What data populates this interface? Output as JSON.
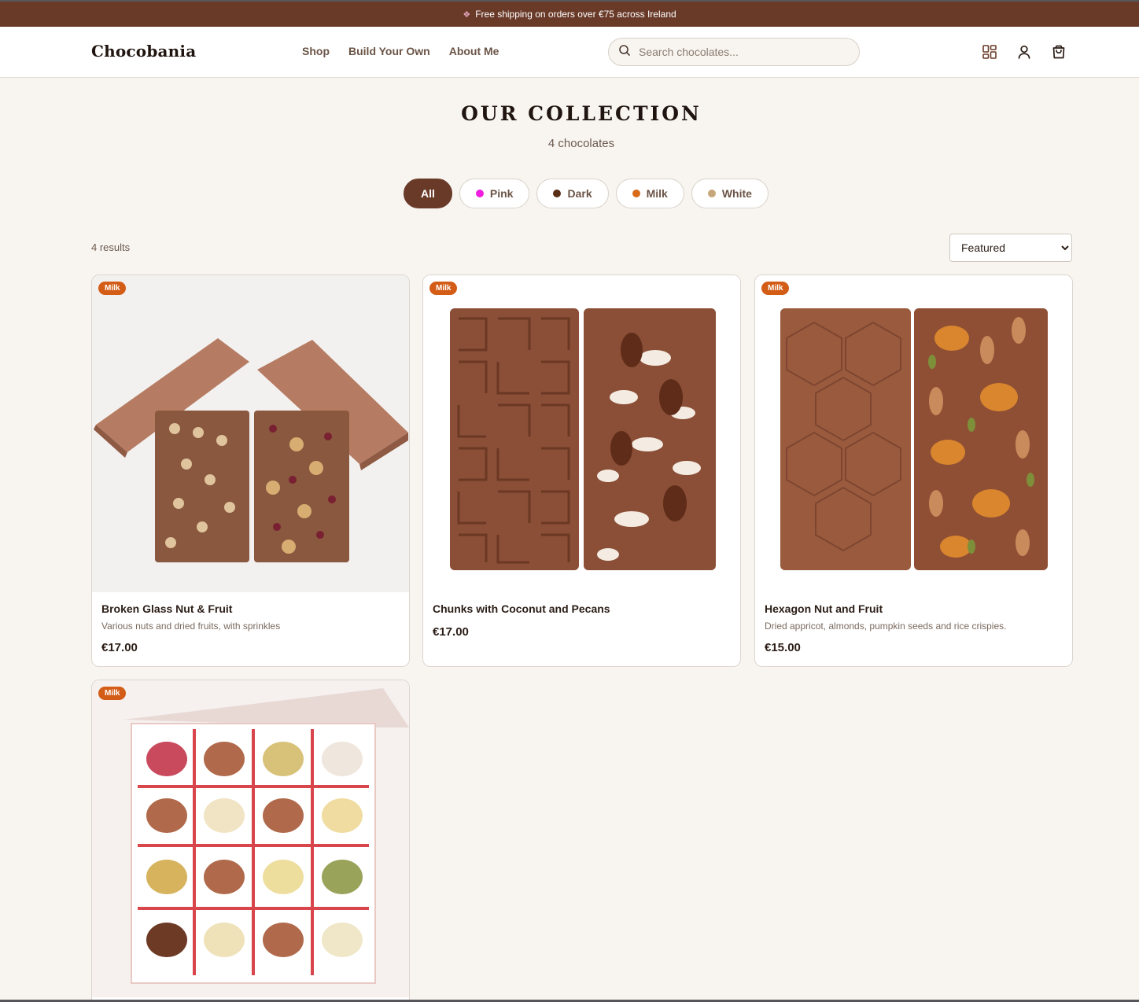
{
  "banner": {
    "icon": "gift-icon",
    "text": "Free shipping on orders over €75 across Ireland"
  },
  "header": {
    "logo": "Chocobania",
    "nav": [
      "Shop",
      "Build Your Own",
      "About Me"
    ],
    "search_placeholder": "Search chocolates...",
    "icons": [
      "grid-icon",
      "user-icon",
      "shopping-bag-icon"
    ]
  },
  "collection": {
    "title": "OUR COLLECTION",
    "subtitle": "4 chocolates",
    "filters": [
      {
        "label": "All",
        "active": true,
        "color": ""
      },
      {
        "label": "Pink",
        "active": false,
        "color": "#f01fe0"
      },
      {
        "label": "Dark",
        "active": false,
        "color": "#5a2e14"
      },
      {
        "label": "Milk",
        "active": false,
        "color": "#d86a1a"
      },
      {
        "label": "White",
        "active": false,
        "color": "#c7a77a"
      }
    ],
    "results": "4 results",
    "sort": {
      "selected": "Featured"
    }
  },
  "products": [
    {
      "badge": "Milk",
      "name": "Broken Glass Nut & Fruit",
      "desc": "Various nuts and dried fruits, with sprinkles",
      "price": "€17.00"
    },
    {
      "badge": "Milk",
      "name": "Chunks with Coconut and Pecans",
      "desc": "",
      "price": "€17.00"
    },
    {
      "badge": "Milk",
      "name": "Hexagon Nut and Fruit",
      "desc": "Dried appricot, almonds, pumpkin seeds and rice crispies.",
      "price": "€15.00"
    },
    {
      "badge": "Milk",
      "name": "",
      "desc": "",
      "price": ""
    }
  ],
  "colors": {
    "brand": "#6a3a29",
    "badge": "#d35d17",
    "background": "#f8f5f1"
  }
}
